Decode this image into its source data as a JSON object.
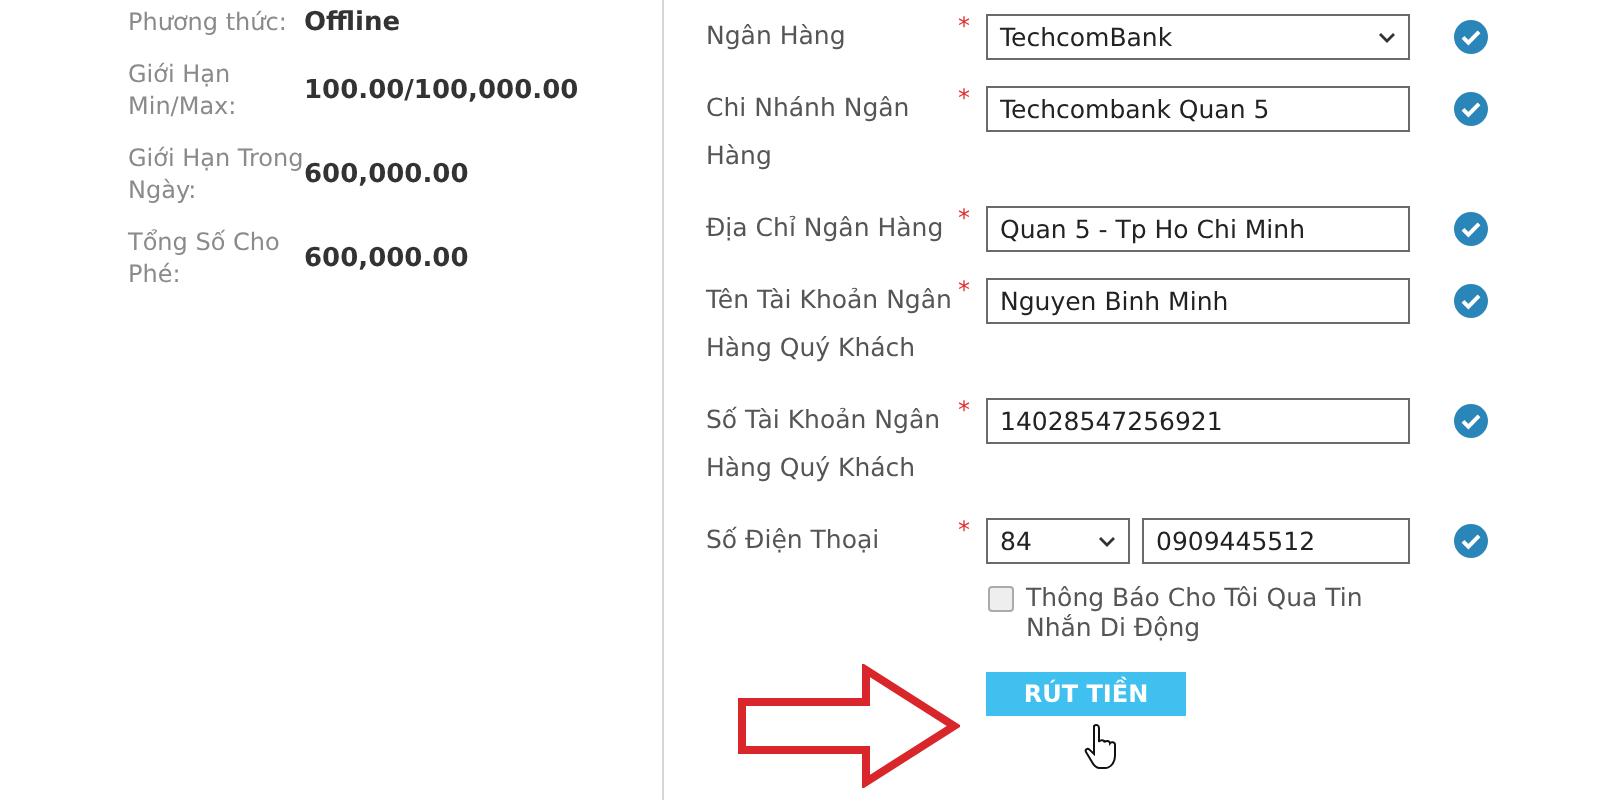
{
  "summary": [
    {
      "label": "Phương thức:",
      "value": "Offline"
    },
    {
      "label": "Giới Hạn Min/Max:",
      "value": "100.00/100,000.00"
    },
    {
      "label": "Giới Hạn Trong Ngày:",
      "value": "600,000.00"
    },
    {
      "label": "Tổng Số Cho Phé:",
      "value": "600,000.00"
    }
  ],
  "form": {
    "fields": [
      {
        "kind": "select",
        "label": "Ngân Hàng",
        "required": "*",
        "value": "TechcomBank",
        "valid": true
      },
      {
        "kind": "text",
        "label": "Chi Nhánh Ngân Hàng",
        "required": "*",
        "value": "Techcombank Quan 5",
        "valid": true
      },
      {
        "kind": "text",
        "label": "Địa Chỉ Ngân Hàng",
        "required": "*",
        "value": "Quan 5 - Tp Ho Chi Minh",
        "valid": true
      },
      {
        "kind": "text",
        "label": "Tên Tài Khoản Ngân Hàng Quý Khách",
        "required": "*",
        "value": "Nguyen Binh Minh",
        "valid": true
      },
      {
        "kind": "text",
        "label": "Số Tài Khoản Ngân Hàng Quý Khách",
        "required": "*",
        "value": "14028547256921",
        "valid": true
      },
      {
        "kind": "phone",
        "label": "Số Điện Thoại",
        "required": "*",
        "code": "84",
        "value": "0909445512",
        "valid": true
      }
    ],
    "sms_notice": {
      "label": "Thông Báo Cho Tôi Qua Tin Nhắn Di Động",
      "checked": false
    },
    "submit": "RÚT TIỀN"
  }
}
